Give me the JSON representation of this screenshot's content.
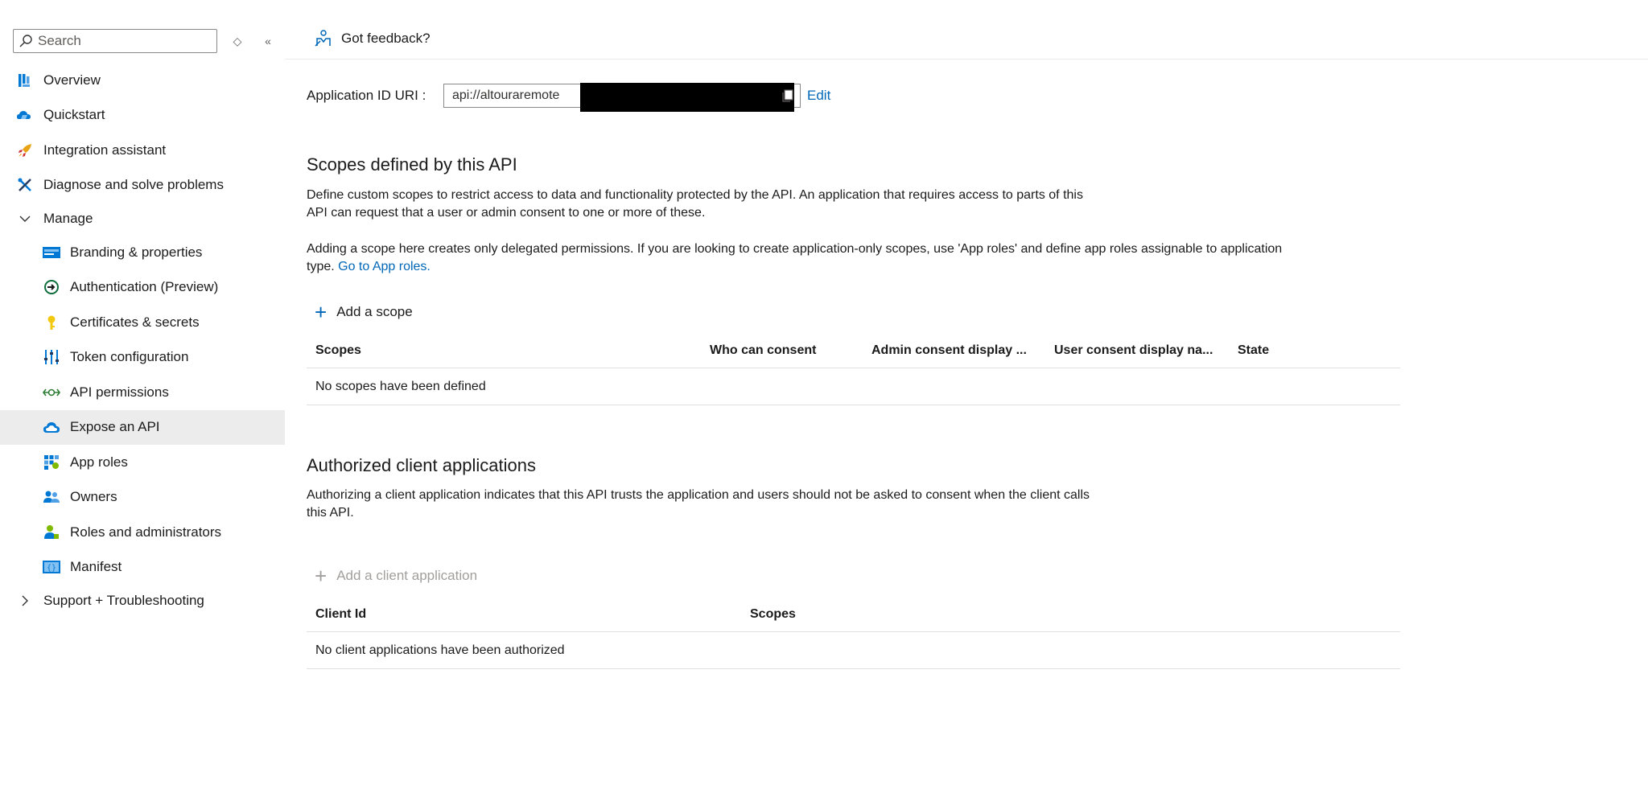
{
  "sidebar": {
    "search_placeholder": "Search",
    "restore_glyph": "◇",
    "collapse_glyph": "«",
    "items": [
      {
        "label": "Overview",
        "icon": "overview-icon"
      },
      {
        "label": "Quickstart",
        "icon": "quickstart-icon"
      },
      {
        "label": "Integration assistant",
        "icon": "rocket-icon"
      },
      {
        "label": "Diagnose and solve problems",
        "icon": "wrench-icon"
      },
      {
        "label": "Manage",
        "icon": "chevron-down-icon"
      },
      {
        "label": "Branding & properties",
        "icon": "branding-icon"
      },
      {
        "label": "Authentication (Preview)",
        "icon": "authentication-icon"
      },
      {
        "label": "Certificates & secrets",
        "icon": "key-icon"
      },
      {
        "label": "Token configuration",
        "icon": "token-icon"
      },
      {
        "label": "API permissions",
        "icon": "api-permissions-icon"
      },
      {
        "label": "Expose an API",
        "icon": "cloud-icon",
        "selected": true
      },
      {
        "label": "App roles",
        "icon": "app-roles-icon"
      },
      {
        "label": "Owners",
        "icon": "owners-icon"
      },
      {
        "label": "Roles and administrators",
        "icon": "roles-icon"
      },
      {
        "label": "Manifest",
        "icon": "manifest-icon"
      },
      {
        "label": "Support + Troubleshooting",
        "icon": "chevron-right-icon"
      }
    ]
  },
  "topbar": {
    "feedback_label": "Got feedback?"
  },
  "app_id": {
    "label": "Application ID URI :",
    "value": "api://altouraremote",
    "edit_label": "Edit"
  },
  "scopes": {
    "title": "Scopes defined by this API",
    "description_line1": "Define custom scopes to restrict access to data and functionality protected by the API. An application that requires access to parts of this",
    "description_line2": "API can request that a user or admin consent to one or more of these.",
    "note_line1": "Adding a scope here creates only delegated permissions. If you are looking to create application-only scopes, use 'App roles' and define app roles assignable to application",
    "note_line2_prefix": "type.",
    "note_link": "Go to App roles.",
    "add_label": "Add a scope",
    "columns": [
      "Scopes",
      "Who can consent",
      "Admin consent display ...",
      "User consent display na...",
      "State"
    ],
    "empty": "No scopes have been defined"
  },
  "clients": {
    "title": "Authorized client applications",
    "description_line1": "Authorizing a client application indicates that this API trusts the application and users should not be asked to consent when the client calls",
    "description_line2": "this API.",
    "add_label": "Add a client application",
    "columns": [
      "Client Id",
      "Scopes"
    ],
    "empty": "No client applications have been authorized"
  },
  "colors": {
    "link": "#0067b8",
    "selected_bg": "#ececec",
    "disabled": "#a19f9d"
  }
}
